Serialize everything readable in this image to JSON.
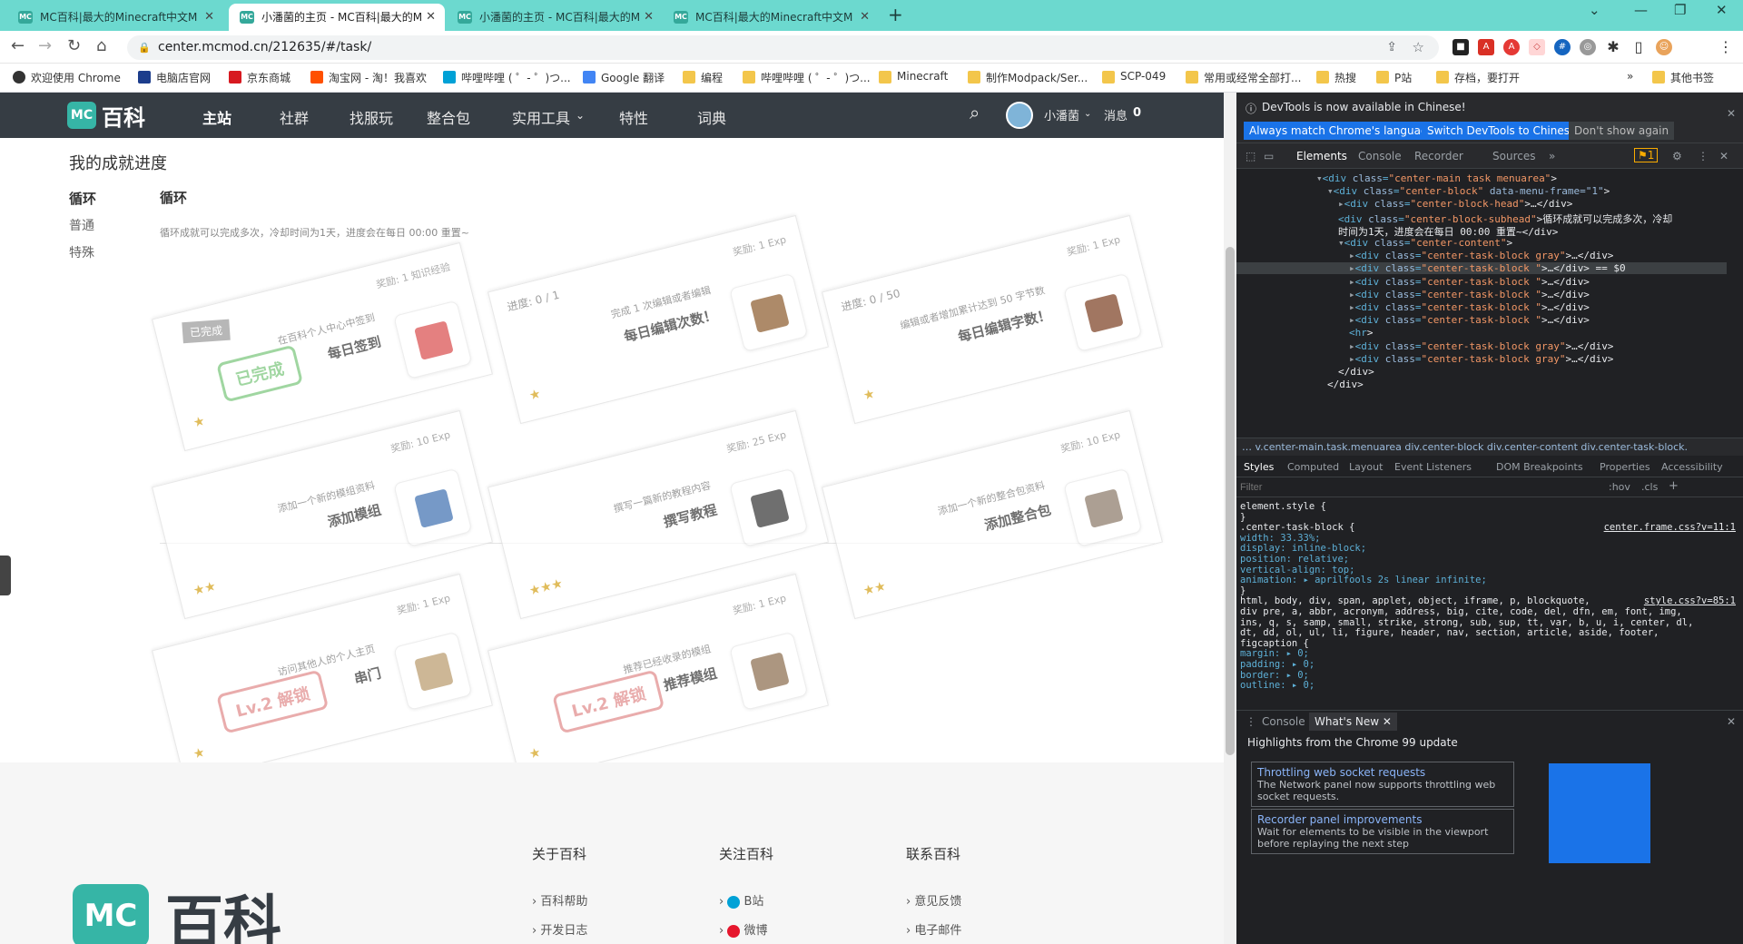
{
  "browser": {
    "tabs": [
      {
        "title": "MC百科|最大的Minecraft中文M",
        "active": false
      },
      {
        "title": "小潘菌的主页 - MC百科|最大的M",
        "active": true
      },
      {
        "title": "小潘菌的主页 - MC百科|最大的M",
        "active": false
      },
      {
        "title": "MC百科|最大的Minecraft中文M",
        "active": false
      }
    ],
    "url": "center.mcmod.cn/212635/#/task/",
    "bookmarks": [
      "欢迎使用 Chrome",
      "电脑店官网",
      "京东商城",
      "淘宝网 - 淘！我喜欢",
      "哔哩哔哩 ( ゜- ゜)つ...",
      "Google 翻译",
      "编程",
      "哔哩哔哩 ( ゜- ゜)つ...",
      "Minecraft",
      "制作Modpack/Ser...",
      "SCP-049",
      "常用或经常全部打...",
      "热搜",
      "P站",
      "存档，要打开"
    ],
    "bookmarks_other": "其他书签",
    "bookmarks_more": "»"
  },
  "site": {
    "logo_text": "MC",
    "logo_title": "百科",
    "nav": [
      "主站",
      "社群",
      "找服玩",
      "整合包",
      "实用工具",
      "特性",
      "词典"
    ],
    "nav_dropdown_caret": "⌄",
    "user_name": "小潘菌",
    "user_caret": "⌄",
    "messages_label": "消息",
    "messages_count": "0"
  },
  "achievements": {
    "heading": "我的成就进度",
    "categories": [
      "循环",
      "普通",
      "特殊"
    ],
    "section_title": "循环",
    "section_sub": "循环成就可以完成多次，冷却时间为1天，进度会在每日 00:00 重置~",
    "cards": [
      {
        "progress": "",
        "stars": "★",
        "title": "每日签到",
        "desc": "在百科个人中心中签到",
        "reward": "奖励: 1 知识经验",
        "stamp": "已完成",
        "stamp_type": "green",
        "tag": "已完成"
      },
      {
        "progress": "进度: 0 / 1",
        "stars": "★",
        "title": "每日编辑次数！",
        "desc": "完成 1 次编辑或者编辑",
        "reward": "奖励: 1 Exp",
        "stamp": "",
        "stamp_type": ""
      },
      {
        "progress": "进度: 0 / 50",
        "stars": "★",
        "title": "每日编辑字数！",
        "desc": "编辑或者增加累计达到 50 字节数",
        "reward": "奖励: 1 Exp",
        "stamp": "",
        "stamp_type": ""
      },
      {
        "progress": "",
        "stars": "★★",
        "title": "添加模组",
        "desc": "添加一个新的模组资料",
        "reward": "奖励: 10 Exp",
        "stamp": "",
        "stamp_type": ""
      },
      {
        "progress": "",
        "stars": "★★★",
        "title": "撰写教程",
        "desc": "撰写一篇新的教程内容",
        "reward": "奖励: 25 Exp",
        "stamp": "",
        "stamp_type": ""
      },
      {
        "progress": "",
        "stars": "★★",
        "title": "添加整合包",
        "desc": "添加一个新的整合包资料",
        "reward": "奖励: 10 Exp",
        "stamp": "",
        "stamp_type": ""
      },
      {
        "progress": "",
        "stars": "★",
        "title": "串门",
        "desc": "访问其他人的个人主页",
        "reward": "奖励: 1 Exp",
        "stamp": "Lv.2 解锁",
        "stamp_type": "red"
      },
      {
        "progress": "",
        "stars": "★",
        "title": "推荐模组",
        "desc": "推荐已经收录的模组",
        "reward": "奖励: 1 Exp",
        "stamp": "Lv.2 解锁",
        "stamp_type": "red"
      }
    ]
  },
  "footer": {
    "logo_text": "MC",
    "logo_title": "百科",
    "columns": [
      {
        "title": "关于百科",
        "links": [
          "百科帮助",
          "开发日志"
        ]
      },
      {
        "title": "关注百科",
        "links": [
          "B站",
          "微博"
        ]
      },
      {
        "title": "联系百科",
        "links": [
          "意见反馈",
          "电子邮件"
        ]
      }
    ],
    "link_arrow": "›"
  },
  "devtools": {
    "info_text": "DevTools is now available in Chinese!",
    "btn_match": "Always match Chrome's language",
    "btn_switch": "Switch DevTools to Chinese",
    "btn_dont": "Don't show again",
    "tabs": [
      "Elements",
      "Console",
      "Recorder",
      "Sources",
      "»"
    ],
    "warning_count": "1",
    "dom_lines": [
      {
        "indent": 90,
        "arrow": "▾",
        "tag": "div",
        "cls": "center-main task menuarea",
        "tail": ">"
      },
      {
        "indent": 102,
        "arrow": "▾",
        "tag": "div",
        "cls": "center-block",
        "extra": " data-menu-frame=\"1\"",
        "tail": ">"
      },
      {
        "indent": 114,
        "arrow": "▸",
        "tag": "div",
        "cls": "center-block-head",
        "tail": ">…</div>"
      },
      {
        "indent": 114,
        "arrow": "",
        "tag": "div",
        "cls": "center-block-subhead",
        "tail": ">循环成就可以完成多次，冷却"
      },
      {
        "indent": 114,
        "arrow": "",
        "tag": "",
        "cls": "",
        "tail": "时间为1天，进度会在每日 00:00 重置~</div>"
      },
      {
        "indent": 114,
        "arrow": "▾",
        "tag": "div",
        "cls": "center-content",
        "tail": ">"
      },
      {
        "indent": 126,
        "arrow": "▸",
        "tag": "div",
        "cls": "center-task-block gray",
        "tail": ">…</div>"
      },
      {
        "indent": 126,
        "arrow": "▸",
        "tag": "div",
        "cls": "center-task-block ",
        "tail": ">…</div> == $0",
        "sel": true
      },
      {
        "indent": 126,
        "arrow": "▸",
        "tag": "div",
        "cls": "center-task-block ",
        "tail": ">…</div>"
      },
      {
        "indent": 126,
        "arrow": "▸",
        "tag": "div",
        "cls": "center-task-block ",
        "tail": ">…</div>"
      },
      {
        "indent": 126,
        "arrow": "▸",
        "tag": "div",
        "cls": "center-task-block ",
        "tail": ">…</div>"
      },
      {
        "indent": 126,
        "arrow": "▸",
        "tag": "div",
        "cls": "center-task-block ",
        "tail": ">…</div>"
      },
      {
        "indent": 126,
        "arrow": "",
        "tag": "hr",
        "cls": "",
        "tail": ">"
      },
      {
        "indent": 126,
        "arrow": "▸",
        "tag": "div",
        "cls": "center-task-block gray",
        "tail": ">…</div>"
      },
      {
        "indent": 126,
        "arrow": "▸",
        "tag": "div",
        "cls": "center-task-block gray",
        "tail": ">…</div>"
      },
      {
        "indent": 114,
        "arrow": "",
        "tag": "",
        "cls": "",
        "tail": "</div>"
      },
      {
        "indent": 102,
        "arrow": "",
        "tag": "",
        "cls": "",
        "tail": "</div>"
      }
    ],
    "breadcrumbs": "…  v.center-main.task.menuarea   div.center-block   div.center-content   div.center-task-block.",
    "style_tabs": [
      "Styles",
      "Computed",
      "Layout",
      "Event Listeners",
      "DOM Breakpoints",
      "Properties",
      "Accessibility"
    ],
    "filter_placeholder": "Filter",
    "filter_hov": ":hov",
    "filter_cls": ".cls",
    "css_lines": [
      "element.style {",
      "}",
      ".center-task-block {",
      "  width: 33.33%;",
      "  display: inline-block;",
      "  position: relative;",
      "  vertical-align: top;",
      "  animation: ▸ aprilfools 2s  linear infinite;",
      "}",
      "html, body, div, span, applet, object, iframe, p, blockquote,",
      "div pre, a, abbr, acronym, address, big, cite, code, del, dfn, em, font, img,",
      "ins, q, s, samp, small, strike, strong, sub, sup, tt, var, b, u, i, center, dl,",
      "dt, dd, ol, ul, li, figure, header, nav, section, article, aside, footer,",
      "figcaption {",
      "  margin: ▸ 0;",
      "  padding: ▸ 0;",
      "  border: ▸ 0;",
      "  outline: ▸ 0;"
    ],
    "css_link1": "center.frame.css?v=11:1",
    "css_link2": "style.css?v=85:1",
    "drawer_tabs": [
      "Console",
      "What's New"
    ],
    "drawer_title": "Highlights from the Chrome 99 update",
    "news": [
      {
        "title": "Throttling web socket requests",
        "desc": "The Network panel now supports throttling web socket requests."
      },
      {
        "title": "Recorder panel improvements",
        "desc": "Wait for elements to be visible in the viewport before replaying the next step"
      }
    ]
  }
}
